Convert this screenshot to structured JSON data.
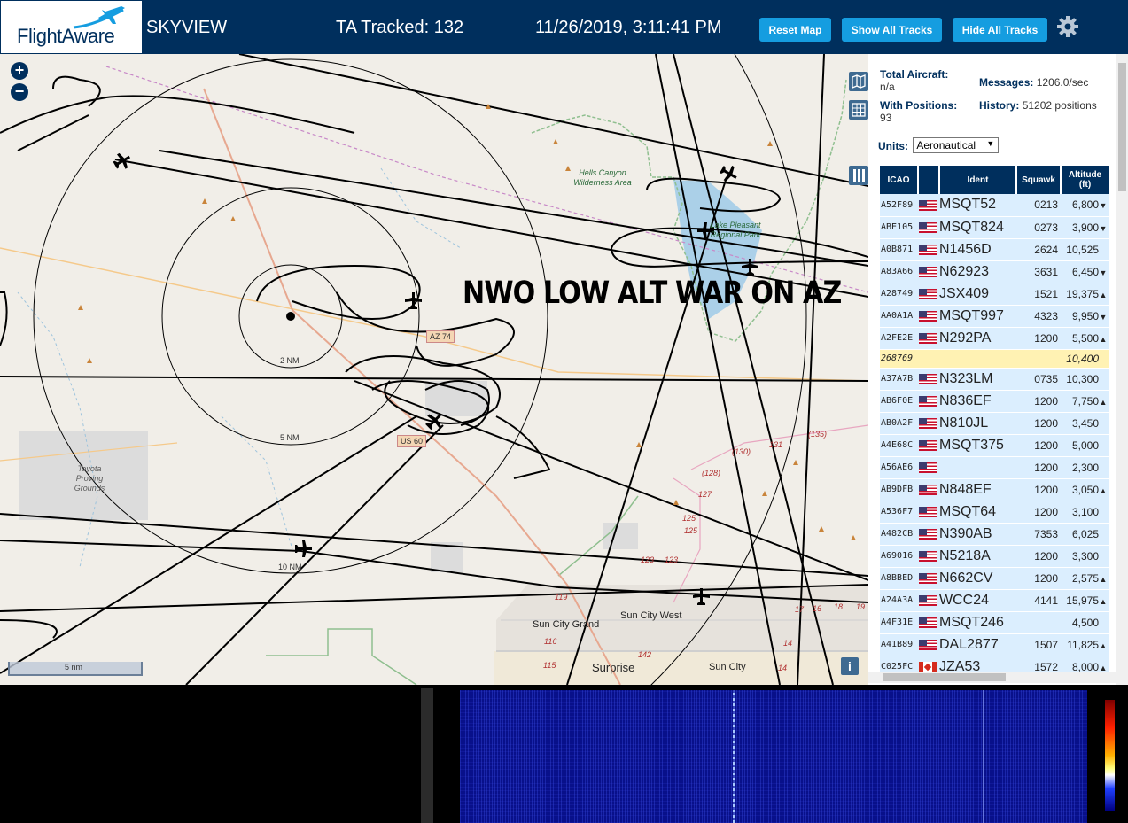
{
  "header": {
    "logo_text": "FlightAware",
    "app_title": "SKYVIEW",
    "ta_tracked": "TA Tracked: 132",
    "datetime": "11/26/2019, 3:11:41 PM",
    "buttons": {
      "reset": "Reset Map",
      "show_all": "Show All Tracks",
      "hide_all": "Hide All Tracks"
    },
    "settings_icon": "gear-icon",
    "brand_color": "#002f5d",
    "button_color": "#159de0"
  },
  "map": {
    "zoom_in": "+",
    "zoom_out": "−",
    "overlay_text": "NWO LOW ALT WAR ON AZ",
    "scale_label": "5 nm",
    "info_label": "i",
    "range_rings": [
      "2 NM",
      "5 NM",
      "10 NM"
    ],
    "labels": {
      "hells_canyon": "Hells Canyon Wilderness Area",
      "lake_pleasant": "Lake Pleasant Regional Park",
      "toyota": "Toyota Proving Grounds",
      "sun_city_grand": "Sun City Grand",
      "sun_city_west": "Sun City West",
      "surprise": "Surprise",
      "sun_city": "Sun City",
      "az74": "AZ 74",
      "us60": "US 60"
    },
    "road_numbers": [
      "(135)",
      "131",
      "(130)",
      "(128)",
      "127",
      "125",
      "125",
      "123",
      "123",
      "119",
      "116",
      "115",
      "142",
      "17",
      "16",
      "18",
      "19",
      "14",
      "14"
    ]
  },
  "stats": {
    "total_label": "Total Aircraft:",
    "total_value": "n/a",
    "messages_label": "Messages:",
    "messages_value": "1206.0/sec",
    "positions_label": "With Positions:",
    "positions_value": "93",
    "history_label": "History:",
    "history_value": "51202 positions",
    "units_label": "Units:",
    "units_value": "Aeronautical"
  },
  "table": {
    "headers": {
      "icao": "ICAO",
      "ident": "Ident",
      "squawk": "Squawk",
      "altitude": "Altitude (ft)"
    },
    "rows": [
      {
        "icao": "A52F89",
        "flag": "us",
        "ident": "MSQT52",
        "squawk": "0213",
        "alt": "6,800",
        "trend": "▼"
      },
      {
        "icao": "ABE105",
        "flag": "us",
        "ident": "MSQT824",
        "squawk": "0273",
        "alt": "3,900",
        "trend": "▼"
      },
      {
        "icao": "A0B871",
        "flag": "us",
        "ident": "N1456D",
        "squawk": "2624",
        "alt": "10,525",
        "trend": ""
      },
      {
        "icao": "A83A66",
        "flag": "us",
        "ident": "N62923",
        "squawk": "3631",
        "alt": "6,450",
        "trend": "▼"
      },
      {
        "icao": "A28749",
        "flag": "us",
        "ident": "JSX409",
        "squawk": "1521",
        "alt": "19,375",
        "trend": "▲"
      },
      {
        "icao": "AA0A1A",
        "flag": "us",
        "ident": "MSQT997",
        "squawk": "4323",
        "alt": "9,950",
        "trend": "▼"
      },
      {
        "icao": "A2FE2E",
        "flag": "us",
        "ident": "N292PA",
        "squawk": "1200",
        "alt": "5,500",
        "trend": "▲"
      },
      {
        "icao": "268769",
        "flag": "",
        "ident": "",
        "squawk": "",
        "alt": "10,400",
        "trend": "",
        "highlight": true
      },
      {
        "icao": "A37A7B",
        "flag": "us",
        "ident": "N323LM",
        "squawk": "0735",
        "alt": "10,300",
        "trend": ""
      },
      {
        "icao": "AB6F0E",
        "flag": "us",
        "ident": "N836EF",
        "squawk": "1200",
        "alt": "7,750",
        "trend": "▲"
      },
      {
        "icao": "AB0A2F",
        "flag": "us",
        "ident": "N810JL",
        "squawk": "1200",
        "alt": "3,450",
        "trend": ""
      },
      {
        "icao": "A4E68C",
        "flag": "us",
        "ident": "MSQT375",
        "squawk": "1200",
        "alt": "5,000",
        "trend": ""
      },
      {
        "icao": "A56AE6",
        "flag": "us",
        "ident": "",
        "squawk": "1200",
        "alt": "2,300",
        "trend": ""
      },
      {
        "icao": "AB9DFB",
        "flag": "us",
        "ident": "N848EF",
        "squawk": "1200",
        "alt": "3,050",
        "trend": "▲"
      },
      {
        "icao": "A536F7",
        "flag": "us",
        "ident": "MSQT64",
        "squawk": "1200",
        "alt": "3,100",
        "trend": ""
      },
      {
        "icao": "A482CB",
        "flag": "us",
        "ident": "N390AB",
        "squawk": "7353",
        "alt": "6,025",
        "trend": ""
      },
      {
        "icao": "A69016",
        "flag": "us",
        "ident": "N5218A",
        "squawk": "1200",
        "alt": "3,300",
        "trend": ""
      },
      {
        "icao": "A8BBED",
        "flag": "us",
        "ident": "N662CV",
        "squawk": "1200",
        "alt": "2,575",
        "trend": "▲"
      },
      {
        "icao": "A24A3A",
        "flag": "us",
        "ident": "WCC24",
        "squawk": "4141",
        "alt": "15,975",
        "trend": "▲"
      },
      {
        "icao": "A4F31E",
        "flag": "us",
        "ident": "MSQT246",
        "squawk": "",
        "alt": "4,500",
        "trend": ""
      },
      {
        "icao": "A41B89",
        "flag": "us",
        "ident": "DAL2877",
        "squawk": "1507",
        "alt": "11,825",
        "trend": "▲"
      },
      {
        "icao": "C025FC",
        "flag": "ca",
        "ident": "JZA53",
        "squawk": "1572",
        "alt": "8,000",
        "trend": "▲"
      }
    ]
  }
}
